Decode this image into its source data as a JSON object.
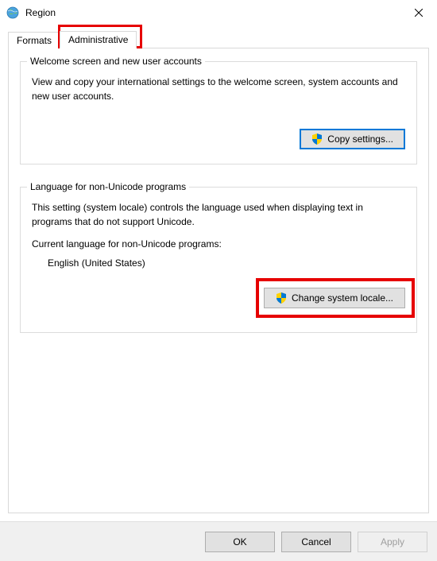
{
  "window": {
    "title": "Region"
  },
  "tabs": {
    "formats": "Formats",
    "administrative": "Administrative"
  },
  "section1": {
    "legend": "Welcome screen and new user accounts",
    "desc": "View and copy your international settings to the welcome screen, system accounts and new user accounts.",
    "button": "Copy settings..."
  },
  "section2": {
    "legend": "Language for non-Unicode programs",
    "desc": "This setting (system locale) controls the language used when displaying text in programs that do not support Unicode.",
    "current_label": "Current language for non-Unicode programs:",
    "current_value": "English (United States)",
    "button": "Change system locale..."
  },
  "footer": {
    "ok": "OK",
    "cancel": "Cancel",
    "apply": "Apply"
  }
}
